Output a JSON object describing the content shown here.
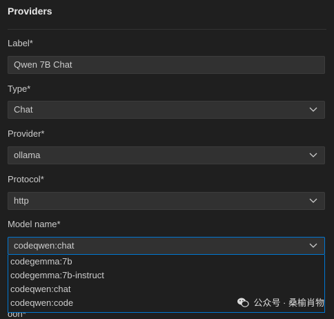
{
  "panel": {
    "title": "Providers"
  },
  "form": {
    "label": {
      "label": "Label*",
      "value": "Qwen 7B Chat"
    },
    "type": {
      "label": "Type*",
      "value": "Chat"
    },
    "provider": {
      "label": "Provider*",
      "value": "ollama"
    },
    "protocol": {
      "label": "Protocol*",
      "value": "http"
    },
    "model": {
      "label": "Model name*",
      "value": "codeqwen:chat",
      "options": [
        "codegemma:7b",
        "codegemma:7b-instruct",
        "codeqwen:chat",
        "codeqwen:code"
      ]
    },
    "next_label_partial": "oon*"
  },
  "watermark": {
    "text": "公众号 · 桑榆肖物"
  },
  "colors": {
    "accent": "#0078d4",
    "background": "#1f1f1f",
    "field": "#313131"
  }
}
